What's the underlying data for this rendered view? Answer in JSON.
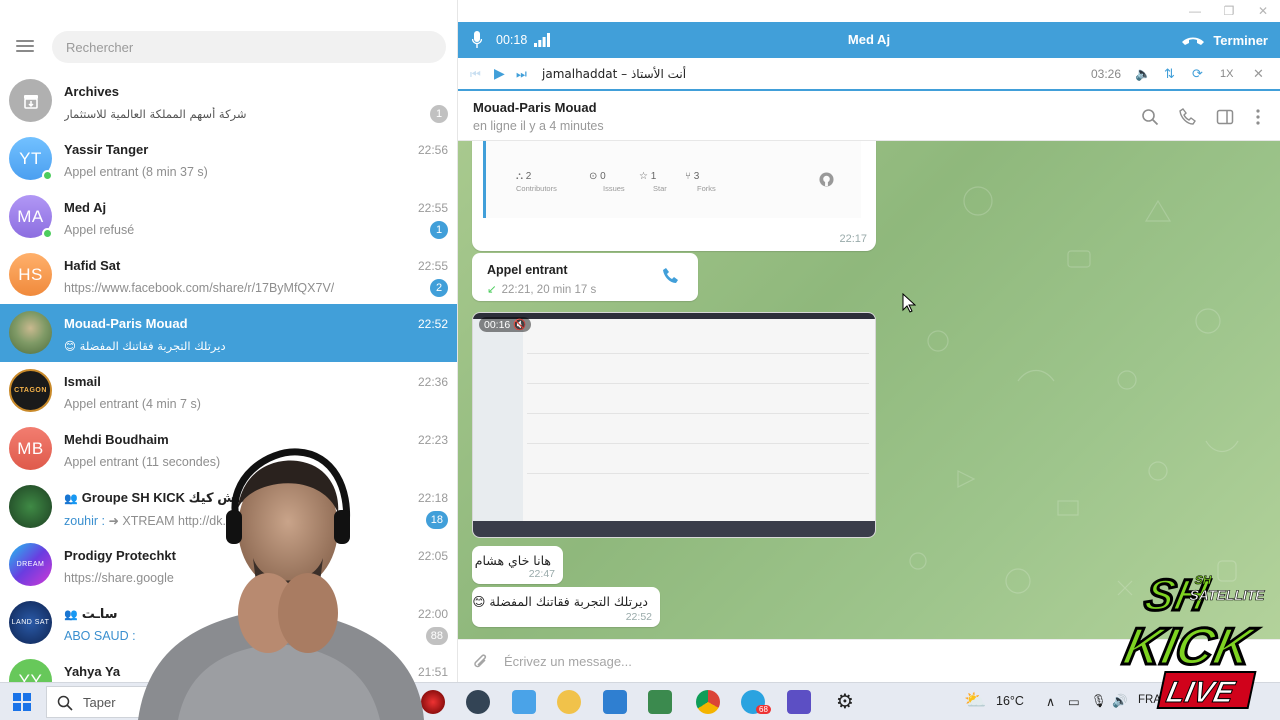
{
  "window": {
    "minimize": "—",
    "restore": "❐",
    "close": "✕"
  },
  "search": {
    "placeholder": "Rechercher"
  },
  "chats": [
    {
      "name": "Archives",
      "time": "",
      "preview": "شركة أسهم المملكة العالمية للاستثمار",
      "badge": "1",
      "badge_muted": true,
      "avatar_text": "",
      "avatar_color": "#b0b0b0",
      "online": false,
      "active": false
    },
    {
      "name": "Yassir Tanger",
      "time": "22:56",
      "preview": "Appel entrant (8 min 37 s)",
      "badge": "",
      "avatar_text": "YT",
      "avatar_color": "#5caffa",
      "online": true,
      "active": false
    },
    {
      "name": "Med Aj",
      "time": "22:55",
      "preview": "Appel refusé",
      "badge": "1",
      "avatar_text": "MA",
      "avatar_color": "#9b7ee8",
      "online": true,
      "active": false
    },
    {
      "name": "Hafid Sat",
      "time": "22:55",
      "preview": "https://www.facebook.com/share/r/17ByMfQX7V/",
      "badge": "2",
      "avatar_text": "HS",
      "avatar_color": "#f59b52",
      "online": false,
      "active": false
    },
    {
      "name": "Mouad-Paris Mouad",
      "time": "22:52",
      "preview": "😊 ديرتلك التجربة فقاتنك المفضلة",
      "badge": "",
      "avatar_text": "",
      "avatar_color": "#6b8a5a",
      "online": false,
      "active": true
    },
    {
      "name": "Ismail",
      "time": "22:36",
      "preview": "Appel entrant (4 min 7 s)",
      "badge": "",
      "avatar_text": "",
      "avatar_color": "#2b2b2b",
      "online": false,
      "active": false
    },
    {
      "name": "Mehdi Boudhaim",
      "time": "22:23",
      "preview": "Appel entrant (11 secondes)",
      "badge": "",
      "avatar_text": "MB",
      "avatar_color": "#e9695c",
      "online": false,
      "active": false
    },
    {
      "name": "Groupe SH KICK ساش كيك",
      "time": "22:18",
      "preview_sender": "zouhir :",
      "preview": "➜ XTREAM    http://dk...  =AHMAD1...",
      "badge": "18",
      "avatar_text": "",
      "avatar_color": "#2f6b3a",
      "online": false,
      "active": false,
      "group": true
    },
    {
      "name": "Prodigy Protechkt",
      "time": "22:05",
      "preview": "https://share.google",
      "badge": "",
      "avatar_text": "",
      "avatar_color": "#5b3fd6",
      "online": false,
      "active": false
    },
    {
      "name": "ساـت",
      "time": "22:00",
      "preview_sender": "ABO SAUD :",
      "preview": "",
      "badge": "88",
      "badge_muted": true,
      "avatar_text": "",
      "avatar_color": "#1d3c78",
      "online": false,
      "active": false,
      "group": true
    },
    {
      "name": "Yahya Ya",
      "time": "21:51",
      "preview": "",
      "badge": "",
      "avatar_text": "YY",
      "avatar_color": "#67c85a",
      "online": false,
      "active": false
    }
  ],
  "call_bar": {
    "timer": "00:18",
    "title": "Med Aj",
    "end_label": "Terminer"
  },
  "music": {
    "track": "jamalhaddat – أنت الأستاذ",
    "duration": "03:26",
    "speed": "1X"
  },
  "header": {
    "name": "Mouad-Paris Mouad",
    "status": "en ligne il y a 4 minutes"
  },
  "github_card": {
    "stats": [
      {
        "value": "2",
        "label": "Contributors"
      },
      {
        "value": "0",
        "label": "Issues"
      },
      {
        "value": "1",
        "label": "Star"
      },
      {
        "value": "3",
        "label": "Forks"
      }
    ],
    "time": "22:17"
  },
  "call_message": {
    "title": "Appel entrant",
    "detail": "22:21, 20 min 17 s"
  },
  "video": {
    "duration": "00:16"
  },
  "messages": [
    {
      "text": "هانا خاي هشام",
      "time": "22:47"
    },
    {
      "text": "ديرتلك التجربة فقاتنك المفضلة 😊",
      "time": "22:52"
    }
  ],
  "compose": {
    "placeholder": "Écrivez un message..."
  },
  "taskbar": {
    "search_placeholder": "Taper",
    "weather": "16°C",
    "lang": "FRA",
    "telegram_badge": "68"
  },
  "logo": {
    "line1": "SH",
    "line2": "SATELLITE",
    "line3": "KICK",
    "line4": "LIVE"
  }
}
